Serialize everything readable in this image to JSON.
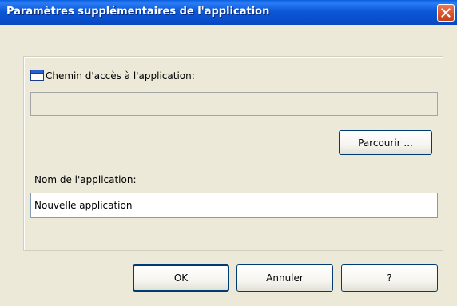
{
  "window": {
    "title": "Paramètres supplémentaires de l'application"
  },
  "form": {
    "path_label": "Chemin d'accès à l'application:",
    "path_value": "",
    "browse_label": "Parcourir ...",
    "name_label": "Nom de l'application:",
    "name_value": "Nouvelle application"
  },
  "buttons": {
    "ok": "OK",
    "cancel": "Annuler",
    "help": "?"
  },
  "icons": {
    "close": "close-icon",
    "path": "window-icon"
  }
}
